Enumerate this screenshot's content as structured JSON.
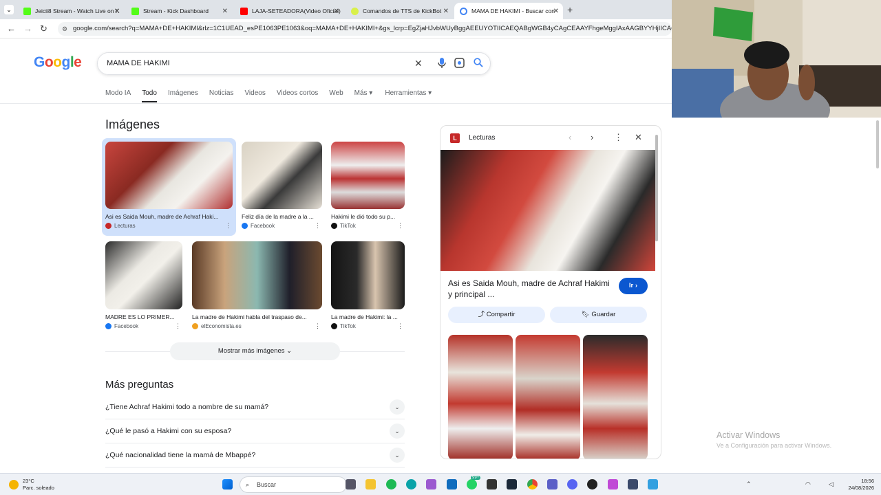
{
  "browser": {
    "tabs": [
      {
        "title": "Jeicii8 Stream - Watch Live on K",
        "color": "#53fc18"
      },
      {
        "title": "Stream - Kick Dashboard",
        "color": "#53fc18"
      },
      {
        "title": "LAJA-SETEADORA(Video Oficial)",
        "color": "#ff0000"
      },
      {
        "title": "Comandos de TTS de KickBot",
        "color": "#d9f04a"
      },
      {
        "title": "MAMA DE HAKIMI - Buscar con",
        "color": "#4285f4"
      }
    ],
    "new_tab": "+",
    "url": "google.com/search?q=MAMA+DE+HAKIMI&rlz=1C1UEAD_esPE1063PE1063&oq=MAMA+DE+HAKIMI+&gs_lcrp=EgZjaHJvbWUyBggAEEUYOTIICAEQABgWGB4yCAgCEAAYFhgeMggIAxAAGBYYHjIICAQQABgWGB"
  },
  "google": {
    "logo": "Google",
    "query": "MAMA DE HAKIMI",
    "tabs": [
      "Modo IA",
      "Todo",
      "Imágenes",
      "Noticias",
      "Videos",
      "Videos cortos",
      "Web",
      "Más ▾",
      "Herramientas ▾"
    ],
    "images_title": "Imágenes",
    "images": [
      {
        "caption": "Asi es Saida Mouh, madre de Achraf Haki...",
        "source": "Lecturas"
      },
      {
        "caption": "Feliz día de la madre a la ...",
        "source": "Facebook"
      },
      {
        "caption": "Hakimi le dió todo su p...",
        "source": "TikTok"
      },
      {
        "caption": "MADRE ES LO PRIMER...",
        "source": "Facebook"
      },
      {
        "caption": "La madre de Hakimi habla del traspaso de...",
        "source": "elEconomista.es"
      },
      {
        "caption": "La madre de Hakimi: la ...",
        "source": "TikTok"
      }
    ],
    "show_more": "Mostrar más imágenes",
    "faq_title": "Más preguntas",
    "faq": [
      "¿Tiene Achraf Hakimi todo a nombre de su mamá?",
      "¿Qué le pasó a Hakimi con su esposa?",
      "¿Qué nacionalidad tiene la mamá de Mbappé?"
    ]
  },
  "panel": {
    "badge": "L",
    "source": "Lecturas",
    "caption": "Asi es Saida Mouh, madre de Achraf Hakimi y principal ...",
    "go": "Ir",
    "share": "Compartir",
    "save": "Guardar"
  },
  "watermark": {
    "line1": "Activar Windows",
    "line2": "Ve a Configuración para activar Windows."
  },
  "taskbar": {
    "temp": "23°C",
    "weather": "Parc. soleado",
    "search": "Buscar",
    "badge1": "99+",
    "time": "18:56",
    "date": "24/08/2026"
  }
}
